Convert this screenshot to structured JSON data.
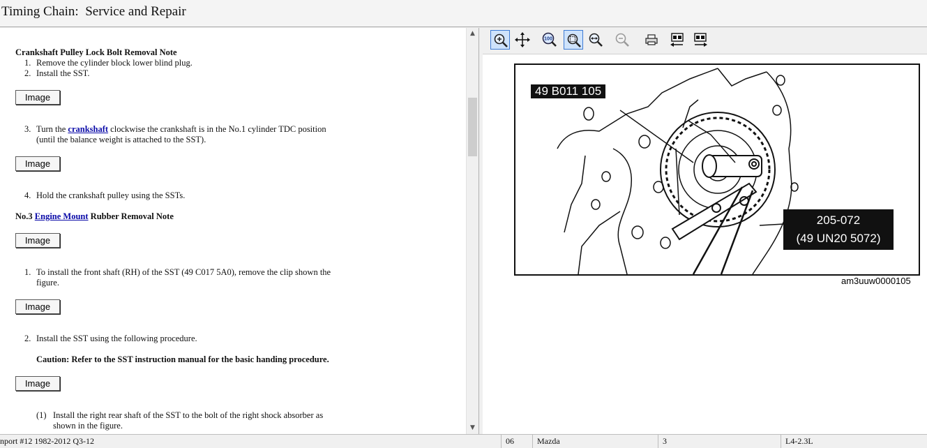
{
  "window": {
    "title": "Timing Chain:  Service and Repair"
  },
  "left": {
    "heading1": "Crankshaft Pulley Lock Bolt Removal Note",
    "step1": {
      "num": "1.",
      "text": "Remove the cylinder block lower blind plug."
    },
    "step2": {
      "num": "2.",
      "text": "Install the SST."
    },
    "step3": {
      "num": "3.",
      "pre": "Turn the ",
      "link": "crankshaft",
      "post": " clockwise the crankshaft is in the No.1 cylinder TDC position",
      "cont": "(until the balance weight is attached to the SST)."
    },
    "step4": {
      "num": "4.",
      "text": "Hold the crankshaft pulley using the SSTs."
    },
    "heading2": {
      "pre": "No.3 ",
      "link": "Engine Mount",
      "post": " Rubber Removal Note"
    },
    "step5": {
      "num": "1.",
      "text": "To install the front shaft (RH) of the SST (49 C017 5A0), remove the clip shown the",
      "cont": "figure."
    },
    "step6": {
      "num": "2.",
      "text": "Install the SST using the following procedure."
    },
    "caution": "Caution: Refer to the SST instruction manual for the basic handing procedure.",
    "step7": {
      "num": "(1)",
      "text": "Install the right rear shaft of the SST to the bolt of the right shock absorber as",
      "cont": "shown in the figure."
    },
    "image_button_label": "Image",
    "scroll_up": "▲",
    "scroll_down": "▼"
  },
  "toolbar": {
    "icons": [
      "zoom-in-icon",
      "pan-icon",
      "zoom-100-icon",
      "zoom-fit-icon",
      "zoom-width-icon",
      "zoom-out-icon",
      "print-icon",
      "previous-image-icon",
      "next-image-icon"
    ],
    "accent": "#3d7bd5"
  },
  "figure": {
    "callout_top": "49 B011 105",
    "callout_bottom_1": "205-072",
    "callout_bottom_2": "(49 UN20 5072)",
    "figure_id": "am3uuw0000105"
  },
  "status": {
    "import": "nport #12 1982-2012 Q3-12",
    "code": "06",
    "make": "Mazda",
    "num": "3",
    "engine": "L4-2.3L"
  }
}
